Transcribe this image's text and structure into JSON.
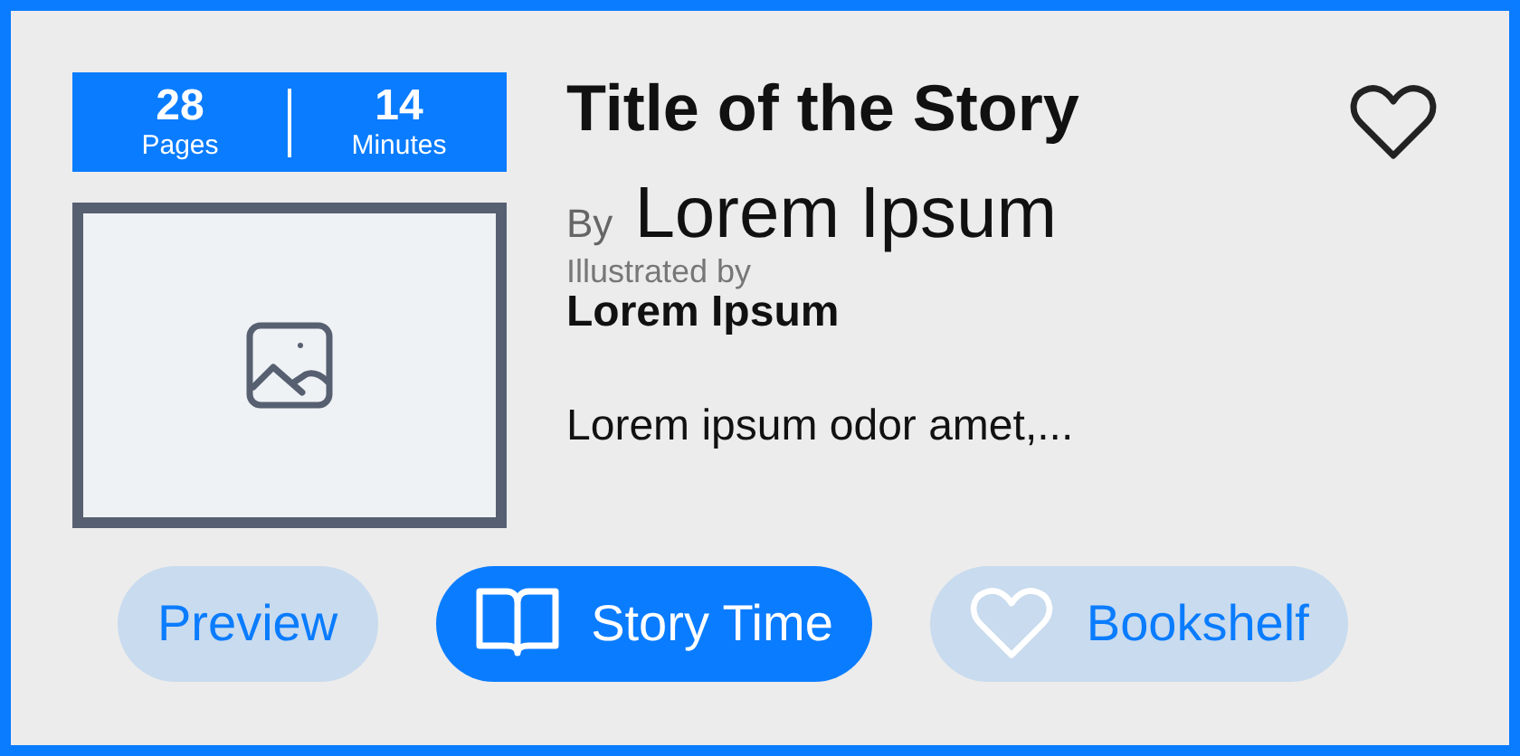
{
  "stats": [
    {
      "value": "28",
      "label": "Pages"
    },
    {
      "value": "14",
      "label": "Minutes"
    }
  ],
  "cover": {
    "kind": "placeholder"
  },
  "title": "Title of the Story",
  "favorite": false,
  "author_prefix": "By",
  "author": "Lorem Ipsum",
  "illustrator_prefix": "Illustrated by",
  "illustrator": "Lorem Ipsum",
  "summary": "Lorem ipsum odor amet,...",
  "buttons": [
    {
      "label": "Preview",
      "kind": "plain"
    },
    {
      "label": "Story Time",
      "kind": "read"
    },
    {
      "label": "Bookshelf",
      "kind": "save"
    }
  ]
}
